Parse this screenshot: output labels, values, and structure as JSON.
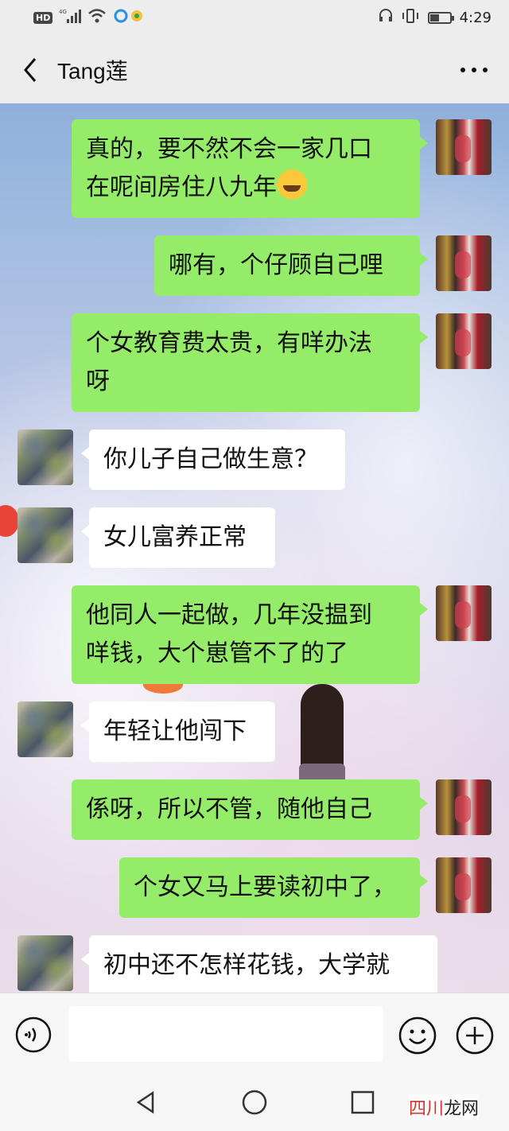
{
  "status_bar": {
    "network_badge": "HD",
    "network_type": "4G",
    "time": "4:29",
    "icons": [
      "hd-badge",
      "signal-icon",
      "wifi-icon",
      "app-icon",
      "headset-icon",
      "vibrate-icon",
      "battery-icon"
    ],
    "battery_level": 0.45
  },
  "header": {
    "title": "Tang莲",
    "back_icon": "chevron-left-icon",
    "more_icon": "more-icon"
  },
  "messages": [
    {
      "sender": "self",
      "lines": [
        "真的，要不然不会一家几口",
        "在呢间房住八九年"
      ],
      "emoji": "rolling-on-floor-laughing"
    },
    {
      "sender": "self",
      "lines": [
        "哪有，个仔顾自己哩"
      ]
    },
    {
      "sender": "self",
      "lines": [
        "个女教育费太贵，有咩办法",
        "呀"
      ]
    },
    {
      "sender": "other",
      "lines": [
        "你儿子自己做生意？"
      ]
    },
    {
      "sender": "other",
      "lines": [
        "女儿富养正常"
      ]
    },
    {
      "sender": "self",
      "lines": [
        "他同人一起做，几年没揾到",
        "咩钱，大个崽管不了的了"
      ]
    },
    {
      "sender": "other",
      "lines": [
        "年轻让他闯下"
      ]
    },
    {
      "sender": "self",
      "lines": [
        "係呀，所以不管，随他自己"
      ]
    },
    {
      "sender": "self",
      "lines": [
        "个女又马上要读初中了，"
      ]
    },
    {
      "sender": "other",
      "lines": [
        "初中还不怎样花钱，大学就"
      ]
    }
  ],
  "input_bar": {
    "voice_icon": "voice-icon",
    "input_value": "",
    "emoji_icon": "smiley-icon",
    "plus_icon": "plus-icon"
  },
  "system_nav": {
    "icons": [
      "back-triangle-icon",
      "home-circle-icon",
      "recent-square-icon"
    ]
  },
  "watermark": {
    "text_a": "四川",
    "text_b": "龙网"
  },
  "colors": {
    "self_bubble": "#95ec69",
    "other_bubble": "#ffffff",
    "bar_bg": "#ededed"
  }
}
